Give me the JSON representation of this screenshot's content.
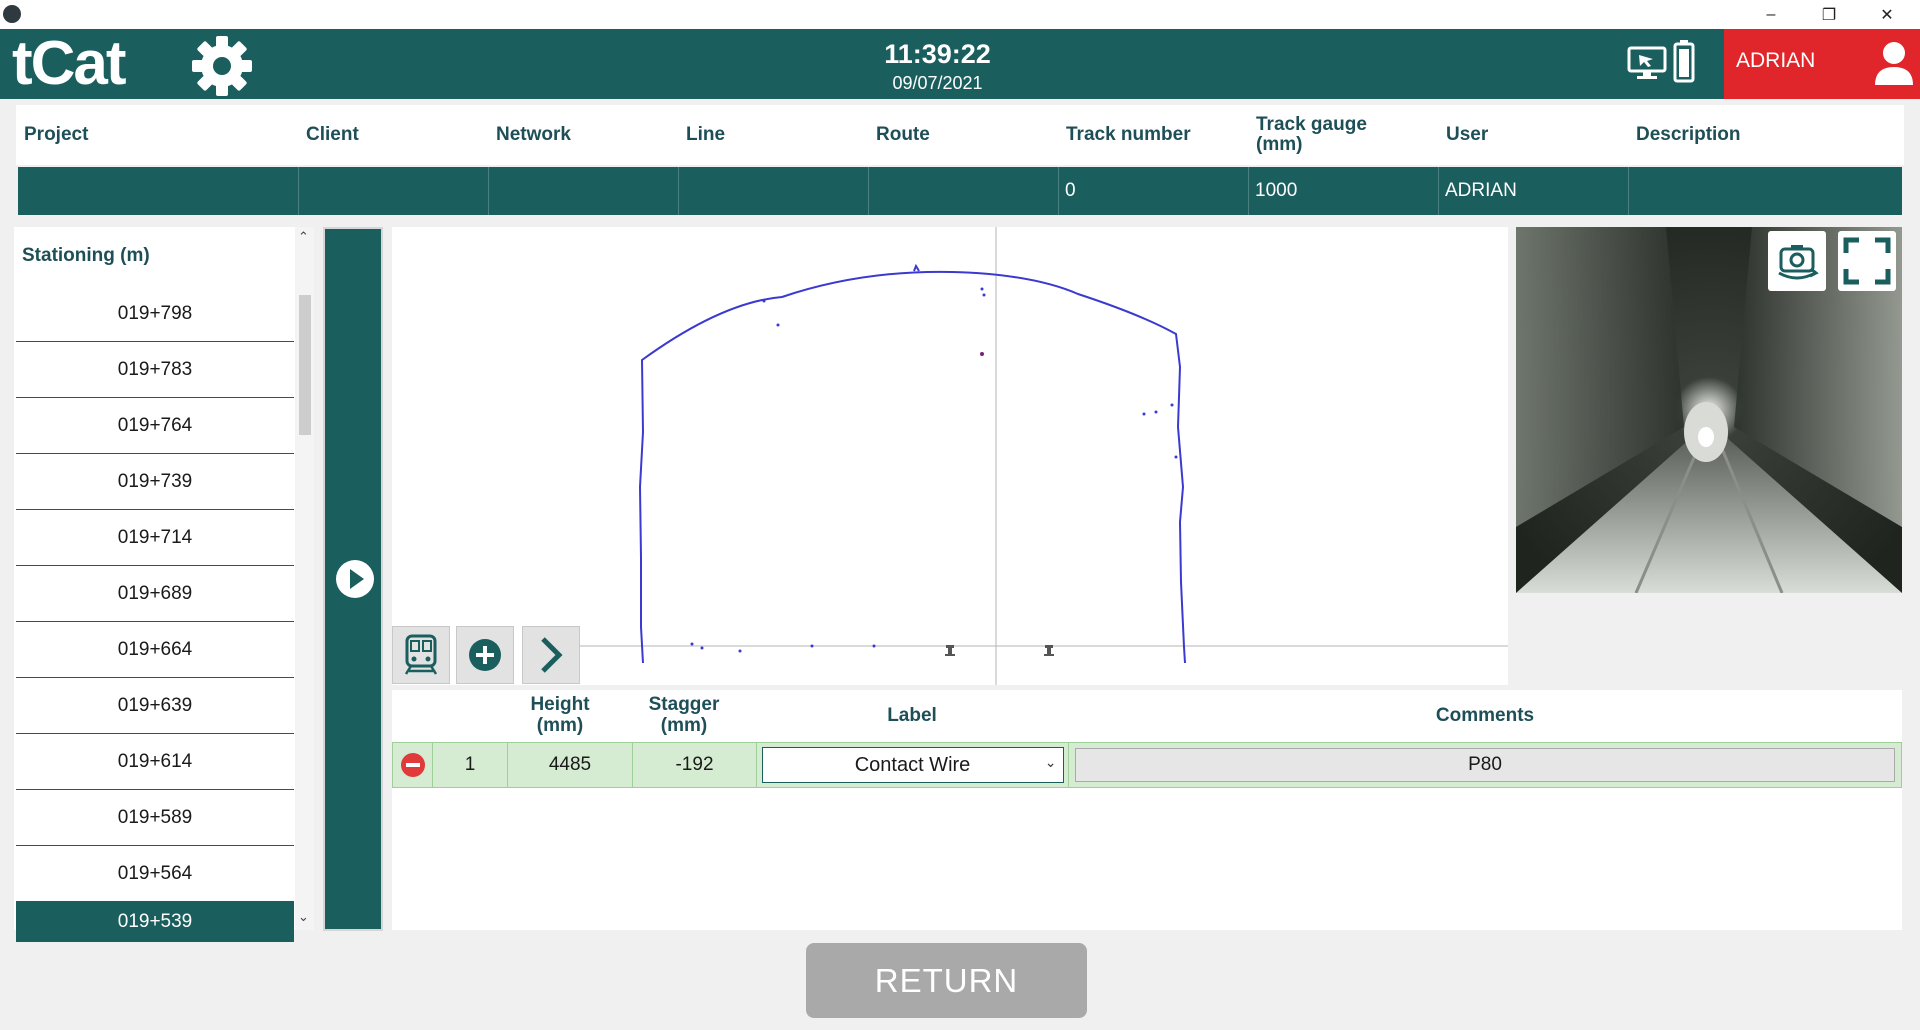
{
  "window": {
    "minimize": "–",
    "restore": "❐",
    "close": "✕"
  },
  "header": {
    "logo": "tCat",
    "time": "11:39:22",
    "date": "09/07/2021",
    "user": "ADRIAN"
  },
  "project_table": {
    "columns": [
      "Project",
      "Client",
      "Network",
      "Line",
      "Route",
      "Track number",
      "Track gauge\n(mm)",
      "User",
      "Description"
    ],
    "values": [
      "",
      "",
      "",
      "",
      "",
      "0",
      "1000",
      "ADRIAN",
      ""
    ]
  },
  "stationing": {
    "title": "Stationing (m)",
    "items": [
      "019+798",
      "019+783",
      "019+764",
      "019+739",
      "019+714",
      "019+689",
      "019+664",
      "019+639",
      "019+614",
      "019+589",
      "019+564",
      "019+539"
    ],
    "selected": "019+539"
  },
  "wire_table": {
    "headers": {
      "height": "Height\n(mm)",
      "stagger": "Stagger\n(mm)",
      "label": "Label",
      "comments": "Comments"
    },
    "rows": [
      {
        "index": "1",
        "height": "4485",
        "stagger": "-192",
        "label": "Contact Wire",
        "comments": "P80"
      }
    ]
  },
  "actions": {
    "return_label": "RETURN"
  },
  "colors": {
    "primary": "#1b5e5e",
    "user_accent": "#e0262a",
    "row_highlight": "#d5ecd2",
    "profile_line": "#3a3ad0"
  },
  "icons": [
    "gear-icon",
    "monitor-icon",
    "battery-icon",
    "user-icon",
    "play-icon",
    "train-icon",
    "add-icon",
    "next-icon",
    "camera-rotate-icon",
    "fullscreen-icon",
    "remove-icon",
    "dropdown-chevron-icon"
  ]
}
